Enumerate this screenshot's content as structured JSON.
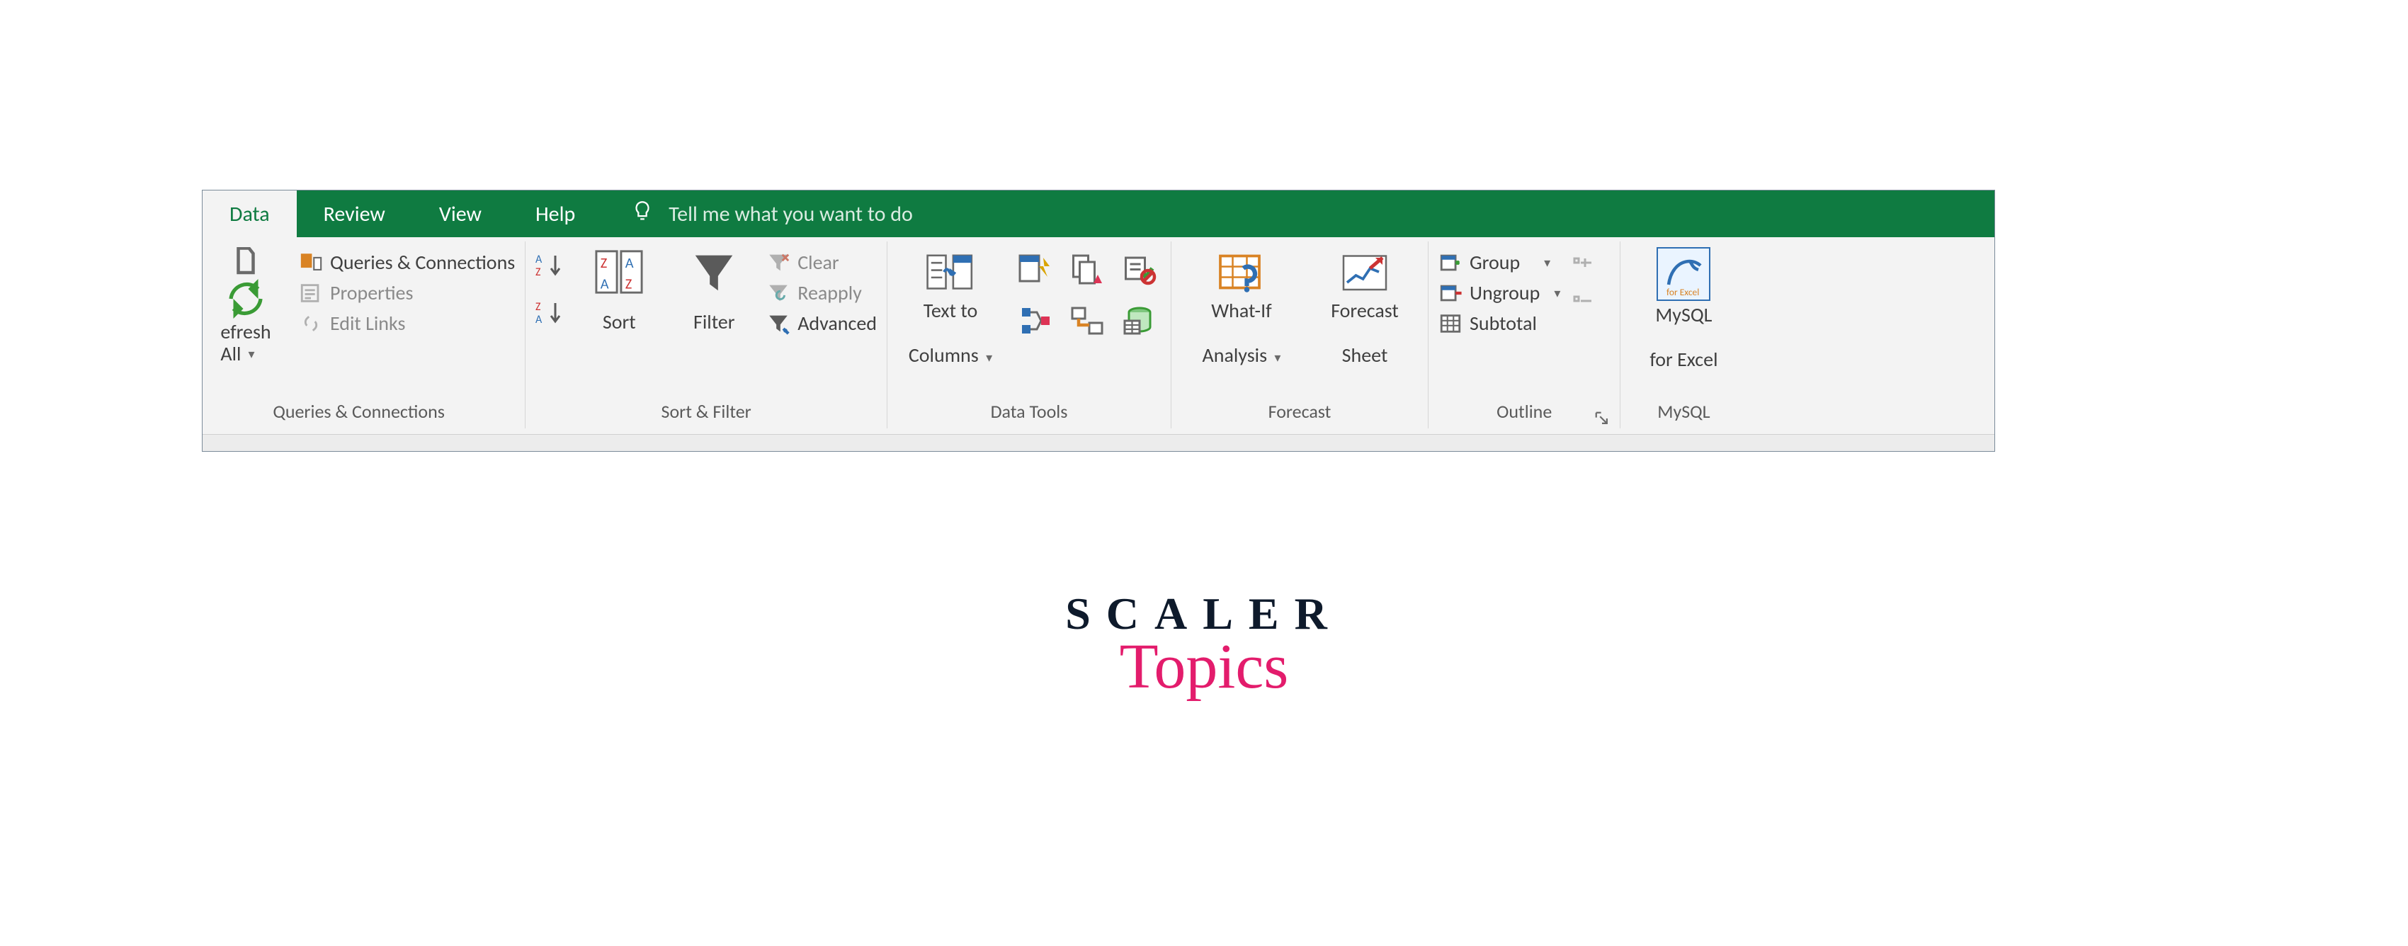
{
  "tabs": {
    "data": "Data",
    "review": "Review",
    "view": "View",
    "help": "Help"
  },
  "tellme": {
    "placeholder": "Tell me what you want to do"
  },
  "group_labels": {
    "queries": "Queries & Connections",
    "sortfilter": "Sort & Filter",
    "datatools": "Data Tools",
    "forecast": "Forecast",
    "outline": "Outline",
    "mysql": "MySQL"
  },
  "queries_group": {
    "refresh_line1": "efresh",
    "refresh_line2": "All",
    "queries_connections": "Queries & Connections",
    "properties": "Properties",
    "edit_links": "Edit Links"
  },
  "sortfilter_group": {
    "sort": "Sort",
    "filter": "Filter",
    "clear": "Clear",
    "reapply": "Reapply",
    "advanced": "Advanced"
  },
  "datatools_group": {
    "text_to_columns_l1": "Text to",
    "text_to_columns_l2": "Columns"
  },
  "forecast_group": {
    "whatif_l1": "What-If",
    "whatif_l2": "Analysis",
    "forecast_sheet_l1": "Forecast",
    "forecast_sheet_l2": "Sheet"
  },
  "outline_group": {
    "group": "Group",
    "ungroup": "Ungroup",
    "subtotal": "Subtotal"
  },
  "mysql_group": {
    "l1": "MySQL",
    "l2": "for Excel"
  },
  "branding": {
    "top": "SCALER",
    "bottom": "Topics"
  }
}
